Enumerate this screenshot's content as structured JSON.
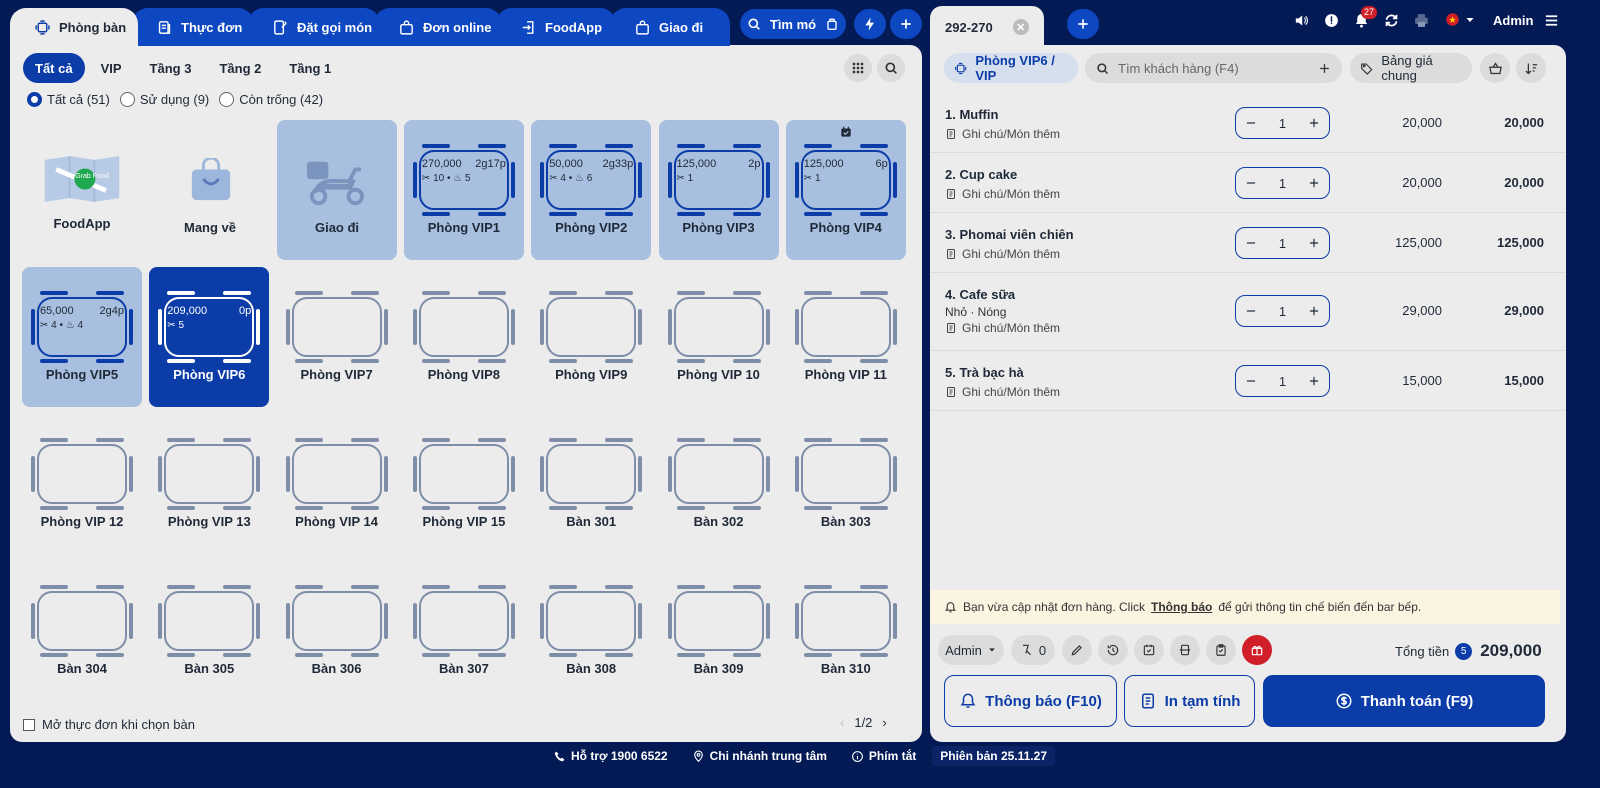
{
  "nav": {
    "tabs": [
      {
        "label": "Phòng bàn",
        "icon": "table-icon",
        "active": true
      },
      {
        "label": "Thực đơn",
        "icon": "menu-icon"
      },
      {
        "label": "Đặt gọi món",
        "icon": "order-icon"
      },
      {
        "label": "Đơn online",
        "icon": "bag-icon"
      },
      {
        "label": "FoodApp",
        "icon": "login-icon"
      },
      {
        "label": "Giao đi",
        "icon": "bag-icon"
      }
    ],
    "search_label": "Tìm mó",
    "accent": "#0b3ca8"
  },
  "floors": [
    "Tất cả",
    "VIP",
    "Tầng 3",
    "Tầng 2",
    "Tầng 1"
  ],
  "filters": [
    {
      "label": "Tất cả (51)",
      "checked": true
    },
    {
      "label": "Sử dụng (9)",
      "checked": false
    },
    {
      "label": "Còn trống (42)",
      "checked": false
    }
  ],
  "special_cards": [
    {
      "name": "FoodApp",
      "icon": "grabfood-map-icon",
      "grab_text": "Grab Food"
    },
    {
      "name": "Mang về",
      "icon": "shopping-bag-icon"
    },
    {
      "name": "Giao đi",
      "icon": "delivery-scooter-icon"
    }
  ],
  "tables": [
    {
      "name": "Phòng VIP1",
      "status": "used",
      "amount": "270,000",
      "time": "2g17p",
      "guests": "10",
      "extra": "5"
    },
    {
      "name": "Phòng VIP2",
      "status": "used",
      "amount": "50,000",
      "time": "2g33p",
      "guests": "4",
      "extra": "6"
    },
    {
      "name": "Phòng VIP3",
      "status": "used",
      "amount": "125,000",
      "time": "2p",
      "guests": "1"
    },
    {
      "name": "Phòng VIP4",
      "status": "used",
      "amount": "125,000",
      "time": "6p",
      "guests": "1",
      "reserved": true
    },
    {
      "name": "Phòng VIP5",
      "status": "used",
      "amount": "65,000",
      "time": "2g4p",
      "guests": "4",
      "extra": "4"
    },
    {
      "name": "Phòng VIP6",
      "status": "selected",
      "amount": "209,000",
      "time": "0p",
      "guests": "5"
    },
    {
      "name": "Phòng VIP7",
      "status": "empty"
    },
    {
      "name": "Phòng VIP8",
      "status": "empty"
    },
    {
      "name": "Phòng VIP9",
      "status": "empty"
    },
    {
      "name": "Phòng VIP 10",
      "status": "empty"
    },
    {
      "name": "Phòng VIP 11",
      "status": "empty"
    },
    {
      "name": "Phòng VIP 12",
      "status": "empty"
    },
    {
      "name": "Phòng VIP 13",
      "status": "empty"
    },
    {
      "name": "Phòng VIP 14",
      "status": "empty"
    },
    {
      "name": "Phòng VIP 15",
      "status": "empty"
    },
    {
      "name": "Bàn 301",
      "status": "empty"
    },
    {
      "name": "Bàn 302",
      "status": "empty"
    },
    {
      "name": "Bàn 303",
      "status": "empty"
    },
    {
      "name": "Bàn 304",
      "status": "empty"
    },
    {
      "name": "Bàn 305",
      "status": "empty"
    },
    {
      "name": "Bàn 306",
      "status": "empty"
    },
    {
      "name": "Bàn 307",
      "status": "empty"
    },
    {
      "name": "Bàn 308",
      "status": "empty"
    },
    {
      "name": "Bàn 309",
      "status": "empty"
    },
    {
      "name": "Bàn 310",
      "status": "empty"
    }
  ],
  "bottom": {
    "open_menu_label": "Mở thực đơn khi chọn bàn",
    "page": "1/2"
  },
  "order": {
    "tab_label": "292-270",
    "room_label": "Phòng VIP6 / VIP",
    "customer_placeholder": "Tìm khách hàng (F4)",
    "pricelist": "Bảng giá chung",
    "items": [
      {
        "name": "1. Muffin",
        "note": "Ghi chú/Món thêm",
        "qty": "1",
        "price": "20,000",
        "total": "20,000"
      },
      {
        "name": "2. Cup cake",
        "note": "Ghi chú/Món thêm",
        "qty": "1",
        "price": "20,000",
        "total": "20,000"
      },
      {
        "name": "3. Phomai viên chiên",
        "note": "Ghi chú/Món thêm",
        "qty": "1",
        "price": "125,000",
        "total": "125,000"
      },
      {
        "name": "4. Cafe sữa",
        "modifiers": "Nhỏ · Nóng",
        "note": "Ghi chú/Món thêm",
        "qty": "1",
        "price": "29,000",
        "total": "29,000"
      },
      {
        "name": "5. Trà bạc hà",
        "note": "Ghi chú/Món thêm",
        "qty": "1",
        "price": "15,000",
        "total": "15,000"
      }
    ],
    "notice_pre": "Bạn vừa cập nhật đơn hàng. Click",
    "notice_link": "Thông báo",
    "notice_post": "để gửi thông tin chế biến đến bar bếp.",
    "staff": "Admin",
    "guest_count": "0",
    "total_label": "Tổng tiền",
    "item_count": "5",
    "total_value": "209,000",
    "btn_notify": "Thông báo (F10)",
    "btn_print": "In tạm tính",
    "btn_pay": "Thanh toán (F9)"
  },
  "topbar": {
    "notifications": "27",
    "user": "Admin"
  },
  "footer": [
    {
      "label": "Hỗ trợ 1900 6522",
      "icon": "phone-icon"
    },
    {
      "label": "Chi nhánh trung tâm",
      "icon": "location-icon"
    },
    {
      "label": "Phím tắt",
      "icon": "info-icon"
    },
    {
      "label": "Phiên bản 25.11.27",
      "icon": ""
    }
  ]
}
